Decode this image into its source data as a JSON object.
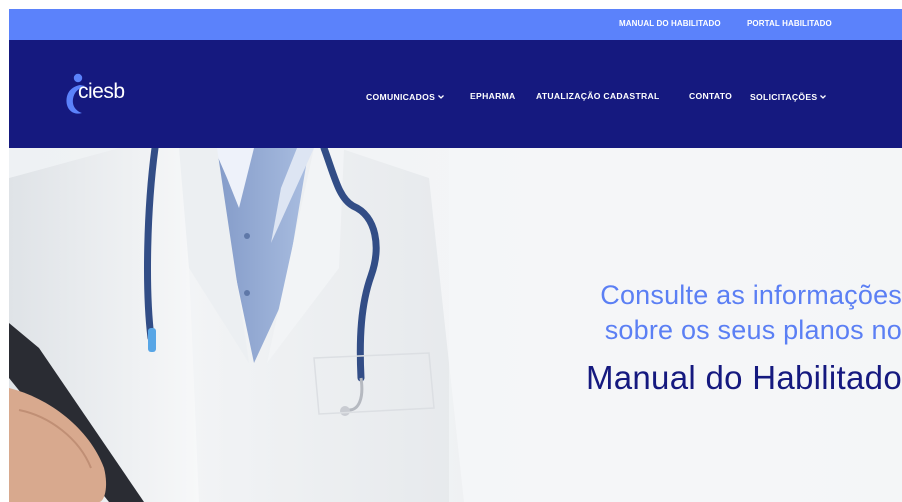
{
  "topbar": {
    "links": [
      {
        "label": "MANUAL DO HABILITADO"
      },
      {
        "label": "PORTAL HABILITADO"
      }
    ]
  },
  "brand": {
    "name": "ciesb"
  },
  "nav": {
    "items": [
      {
        "label": "COMUNICADOS",
        "icon": "chevron-down-icon"
      },
      {
        "label": "EPHARMA"
      },
      {
        "label": "ATUALIZAÇÃO CADASTRAL"
      },
      {
        "label": "CONTATO"
      },
      {
        "label": "SOLICITAÇÕES",
        "icon": "chevron-down-icon"
      }
    ]
  },
  "hero": {
    "line1": "Consulte as informações",
    "line2": "sobre os seus planos no",
    "line3": "Manual do Habilitado"
  },
  "colors": {
    "topbar": "#5b82fb",
    "navbar": "#15197f",
    "hero_accent": "#5b7ff4",
    "hero_title": "#15197f"
  }
}
